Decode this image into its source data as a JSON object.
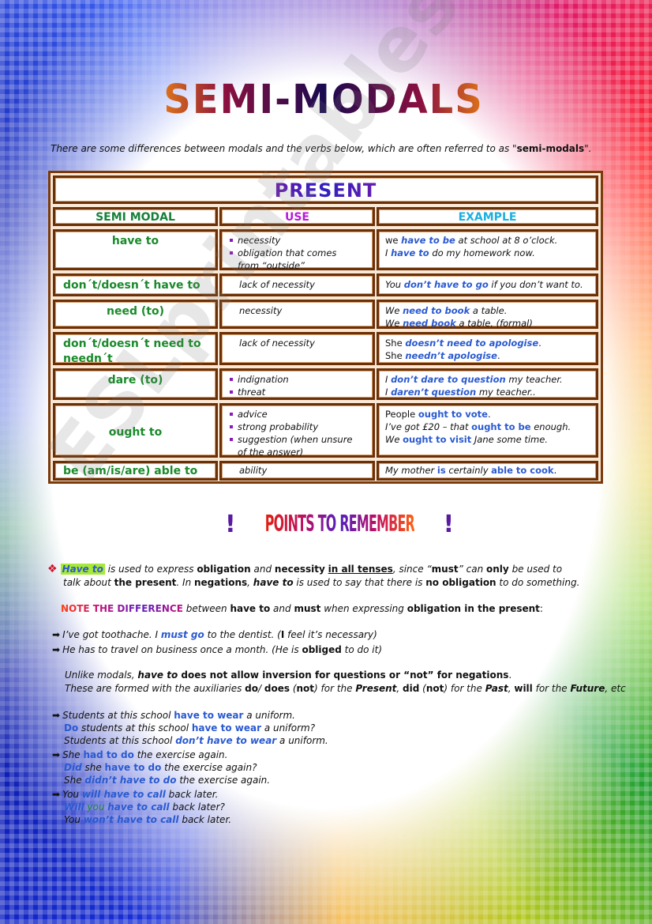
{
  "title": "SEMI-MODALS",
  "intro": {
    "text": "There are some differences between modals and the verbs below, which are often referred to as \"",
    "bold": "semi-modals",
    "end": "\"."
  },
  "table": {
    "section_title": "PRESENT",
    "headers": {
      "modal": "SEMI   MODAL",
      "use": "USE",
      "example": "EXAMPLE"
    },
    "rows": [
      {
        "modal": "have to",
        "uses": [
          "necessity",
          "obligation that comes",
          "from “outside”"
        ],
        "examples": [
          {
            "pre": "we ",
            "hl": "have to be",
            "post": " at school at 8 o’clock."
          },
          {
            "pre": "I ",
            "hl": "have to",
            "post": " do my homework now."
          }
        ]
      },
      {
        "modal": "don´t/doesn´t have to",
        "uses": [
          "lack of necessity"
        ],
        "examples": [
          {
            "pre": "You ",
            "hl": "don’t have to go",
            "post": " if you don’t want to."
          }
        ]
      },
      {
        "modal": "need (to)",
        "uses": [
          "necessity"
        ],
        "examples": [
          {
            "pre": "We ",
            "hl": "need to book",
            "post": " a table."
          },
          {
            "pre": "We ",
            "hl": "need book",
            "post": " a table. (formal)"
          }
        ]
      },
      {
        "modal": "don´t/doesn´t need to",
        "modal2": "needn´t",
        "uses": [
          "lack of necessity"
        ],
        "examples": [
          {
            "pre": "She ",
            "hl": "doesn’t need to apologise",
            "post": "."
          },
          {
            "pre": "She ",
            "hl": "needn’t apologise",
            "post": "."
          }
        ]
      },
      {
        "modal": "dare (to)",
        "uses": [
          "indignation",
          "threat"
        ],
        "examples": [
          {
            "pre": "I ",
            "hl": "don’t dare to question",
            "post": " my teacher."
          },
          {
            "pre": "I ",
            "hl": "daren’t question",
            "post": " my teacher.."
          }
        ]
      },
      {
        "modal": "ought to",
        "uses": [
          "advice",
          "strong probability",
          "suggestion (when unsure",
          "of the answer)"
        ],
        "examples": [
          {
            "pre": "People ",
            "hl": "ought to vote",
            "post": "."
          },
          {
            "pre": "I’ve got £20 – that ",
            "hl": "ought to be",
            "post": " enough."
          },
          {
            "pre": "We ",
            "hl": "ought to visit",
            "post": " Jane some time."
          }
        ]
      },
      {
        "modal": "be (am/is/are) able to",
        "uses": [
          "ability"
        ],
        "examples": [
          {
            "pre": "My mother ",
            "hl": "is",
            "mid": " certainly ",
            "hl2": "able to cook",
            "post": "."
          }
        ]
      }
    ]
  },
  "points_heading": "POINTS TO REMEMBER",
  "points_bang": "!",
  "rule": {
    "highlight": "Have to",
    "t1": " is used to express ",
    "b1": "obligation",
    "t2": "  and ",
    "b2": "necessity",
    "t3": " ",
    "u1": "in all tenses",
    "t4": ", since “",
    "b3": "must",
    "t5": "” can ",
    "b4": "only",
    "t6": " be used to",
    "t7": "talk about ",
    "b5": "the present",
    "t8": ". In ",
    "b6": "negations",
    "t9": ", ",
    "bi1": "have to",
    "t10": "  is used to say that there is ",
    "b7": "no obligation",
    "t11": " to do something."
  },
  "note": {
    "label": "NOTE THE DIFFERENCE",
    "t1": "  between ",
    "b1": "have to",
    "t2": " and ",
    "b2": "must",
    "t3": " when expressing ",
    "b3": "obligation in the present",
    "t4": ":"
  },
  "compare": [
    {
      "pre": "I’ve got toothache. I ",
      "hl": "must go",
      "post": " to the dentist. (",
      "b": "I",
      "post2": " feel it’s necessary)"
    },
    {
      "pre": "He has to travel on business once a month. (He is ",
      "b": "obliged",
      "post": " to do it)"
    }
  ],
  "unlike": {
    "t1": "Unlike modals, ",
    "bi": "have to",
    "b": " does not allow inversion for questions or “not” for negations",
    "t2": ".",
    "l2_t1": "These are formed with the auxiliaries ",
    "l2_b1": "do",
    "l2_t2": "/ ",
    "l2_b2": "does",
    "l2_t3": " (",
    "l2_b3": "not",
    "l2_t4": ") for the ",
    "l2_bi1": "Present",
    "l2_t5": ", ",
    "l2_b4": "did",
    "l2_t6": " (",
    "l2_b5": "not",
    "l2_t7": ") for the ",
    "l2_bi2": "Past",
    "l2_t8": ", ",
    "l2_b6": "will",
    "l2_t9": " for the ",
    "l2_bi3": "Future",
    "l2_t10": ", etc"
  },
  "examples": [
    {
      "pre": "Students at this school ",
      "hl": "have to wear",
      "post": " a uniform."
    },
    {
      "hl0": "Do",
      "pre": " students at this school ",
      "hl": "have to wear",
      "post": " a uniform?"
    },
    {
      "pre": "Students at this school ",
      "hl": "don’t have to wear",
      "post": " a uniform."
    },
    {
      "pre": "She ",
      "hl": "had to do",
      "post": " the exercise again."
    },
    {
      "hl0": "Did",
      "pre": " she ",
      "hl": "have to do",
      "post": " the exercise again?"
    },
    {
      "pre": "She ",
      "hl": "didn’t have to do",
      "post": " the exercise again."
    },
    {
      "pre": "You ",
      "hl": "will have to call",
      "post": " back later."
    },
    {
      "hl0": "Will",
      "green": " you ",
      "hl": "have to call",
      "post": " back later?"
    },
    {
      "pre": "You ",
      "hl": "won’t have to call",
      "post": " back later."
    }
  ],
  "icons": {
    "bullet": "diamond-cluster-icon",
    "arrow": "➡"
  },
  "watermark": "ESLprintables.com",
  "colors": {
    "modal_green": "#1a8a2a",
    "example_blue": "#2a5ad0",
    "border_brown": "#6a3008",
    "highlight_green": "#a8e838"
  }
}
